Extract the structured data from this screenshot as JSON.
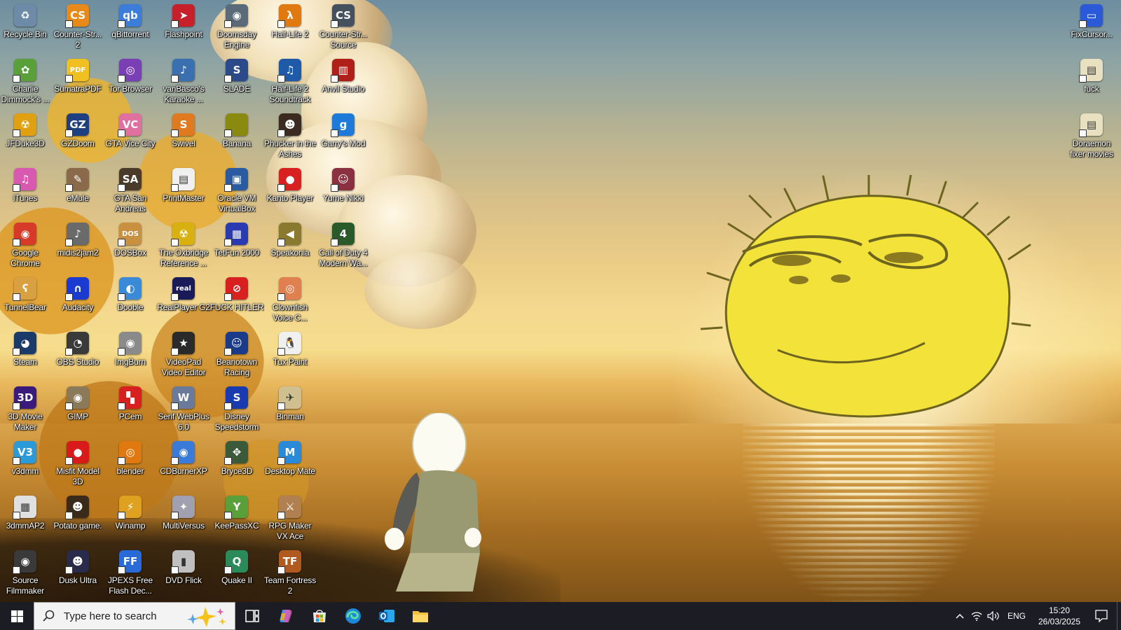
{
  "desktop": {
    "icons": [
      {
        "label": "Recycle Bin",
        "color": "#6d8aa8",
        "glyph": "♻",
        "shortcut": false
      },
      {
        "label": "Counter-Str... 2",
        "color": "#e88a1a",
        "glyph": "CS"
      },
      {
        "label": "qBittorrent",
        "color": "#3b7dd8",
        "glyph": "qb"
      },
      {
        "label": "Flashpoint",
        "color": "#c8202a",
        "glyph": "➤"
      },
      {
        "label": "Doomsday Engine",
        "color": "#5a6a78",
        "glyph": "◉"
      },
      {
        "label": "Half-Life 2",
        "color": "#e07a10",
        "glyph": "λ"
      },
      {
        "label": "Counter-Str... Source",
        "color": "#45505e",
        "glyph": "CS"
      },
      {
        "label": "Charlie Dimmock's ...",
        "color": "#5aa03a",
        "glyph": "✿"
      },
      {
        "label": "SumatraPDF",
        "color": "#f0c020",
        "glyph": "PDF"
      },
      {
        "label": "Tor Browser",
        "color": "#7a3fb5",
        "glyph": "◎"
      },
      {
        "label": "vanBasco's Karaoke ...",
        "color": "#3a6fb0",
        "glyph": "♪"
      },
      {
        "label": "SLADE",
        "color": "#2a4a8a",
        "glyph": "S"
      },
      {
        "label": "Half-Life 2 Soundtrack",
        "color": "#1e5aa8",
        "glyph": "♫"
      },
      {
        "label": "Anvil Studio",
        "color": "#b0201a",
        "glyph": "▥"
      },
      {
        "label": "JFDuke3D",
        "color": "#e0a010",
        "glyph": "☢"
      },
      {
        "label": "GZDoom",
        "color": "#1e3f80",
        "glyph": "GZ"
      },
      {
        "label": "GTA Vice City",
        "color": "#e070a0",
        "glyph": "VC"
      },
      {
        "label": "Swivel",
        "color": "#e07a20",
        "glyph": "S"
      },
      {
        "label": "Banana",
        "color": "#8a8a10",
        "glyph": ""
      },
      {
        "label": "Phucker in the Ashes",
        "color": "#3a2a20",
        "glyph": "☻"
      },
      {
        "label": "Garry's Mod",
        "color": "#1e7ad8",
        "glyph": "g"
      },
      {
        "label": "iTunes",
        "color": "#d85ab0",
        "glyph": "♫"
      },
      {
        "label": "eMule",
        "color": "#8a6a4a",
        "glyph": "✎"
      },
      {
        "label": "GTA San Andreas",
        "color": "#4a3a2a",
        "glyph": "SA"
      },
      {
        "label": "PrintMaster",
        "color": "#f0f0f0",
        "glyph": "▤"
      },
      {
        "label": "Oracle VM VirtualBox",
        "color": "#2a5aa0",
        "glyph": "▣"
      },
      {
        "label": "Kanto Player",
        "color": "#d82020",
        "glyph": "●"
      },
      {
        "label": "Yume Nikki",
        "color": "#8a3040",
        "glyph": "☺"
      },
      {
        "label": "Google Chrome",
        "color": "#d83a2a",
        "glyph": "◉"
      },
      {
        "label": "midis2jam2",
        "color": "#6a6a6a",
        "glyph": "♪"
      },
      {
        "label": "DOSBox",
        "color": "#c89040",
        "glyph": "DOS"
      },
      {
        "label": "The Oxbridge Reference ...",
        "color": "#d8b010",
        "glyph": "☢"
      },
      {
        "label": "TetFun 2000",
        "color": "#2a3ab0",
        "glyph": "▦"
      },
      {
        "label": "Speakonia",
        "color": "#8a7a30",
        "glyph": "◀"
      },
      {
        "label": "Call of Duty 4 Modern Wa...",
        "color": "#2a5a2a",
        "glyph": "4"
      },
      {
        "label": "TunnelBear",
        "color": "#d8a040",
        "glyph": "ʕ"
      },
      {
        "label": "Audacity",
        "color": "#1a3ad0",
        "glyph": "∩"
      },
      {
        "label": "Dooble",
        "color": "#3a8ad8",
        "glyph": "◐"
      },
      {
        "label": "RealPlayer G2",
        "color": "#1a1a5a",
        "glyph": "real"
      },
      {
        "label": "FUCK HITLER",
        "color": "#d82020",
        "glyph": "⊘"
      },
      {
        "label": "Clownfish Voice C...",
        "color": "#e08050",
        "glyph": "◎"
      },
      {
        "label": "Steam",
        "color": "#1a3a6a",
        "glyph": "◕"
      },
      {
        "label": "OBS Studio",
        "color": "#3a3a3a",
        "glyph": "◔"
      },
      {
        "label": "ImgBurn",
        "color": "#8a8a8a",
        "glyph": "◉"
      },
      {
        "label": "VideoPad Video Editor",
        "color": "#2a2a2a",
        "glyph": "★"
      },
      {
        "label": "Beanotown Racing",
        "color": "#1a3a8a",
        "glyph": "☺"
      },
      {
        "label": "Tux Paint",
        "color": "#f0f0f0",
        "glyph": "🐧"
      },
      {
        "label": "3D Movie Maker",
        "color": "#3a1a7a",
        "glyph": "3D"
      },
      {
        "label": "GIMP",
        "color": "#8a7a5a",
        "glyph": "◉"
      },
      {
        "label": "PCem",
        "color": "#d82020",
        "glyph": "▚"
      },
      {
        "label": "Serif WebPlus 6.0",
        "color": "#6a7a9a",
        "glyph": "W"
      },
      {
        "label": "Disney Speedstorm",
        "color": "#1a3ab0",
        "glyph": "S"
      },
      {
        "label": "Binman",
        "color": "#d0c090",
        "glyph": "✈"
      },
      {
        "label": "v3dmm",
        "color": "#2a9ad8",
        "glyph": "V3"
      },
      {
        "label": "Misfit Model 3D",
        "color": "#d81a1a",
        "glyph": "●"
      },
      {
        "label": "blender",
        "color": "#e07a10",
        "glyph": "◎"
      },
      {
        "label": "CDBurnerXP",
        "color": "#3a7ad8",
        "glyph": "◉"
      },
      {
        "label": "Bryce3D",
        "color": "#3a5a3a",
        "glyph": "✥"
      },
      {
        "label": "Desktop Mate",
        "color": "#2a8ad8",
        "glyph": "M"
      },
      {
        "label": "3dmmAP2",
        "color": "#e0e0e0",
        "glyph": "▦"
      },
      {
        "label": "Potato game.",
        "color": "#3a2a1a",
        "glyph": "☻"
      },
      {
        "label": "Winamp",
        "color": "#e0a020",
        "glyph": "⚡"
      },
      {
        "label": "MultiVersus",
        "color": "#a0a0b0",
        "glyph": "✦"
      },
      {
        "label": "KeePassXC",
        "color": "#5aa03a",
        "glyph": "Y"
      },
      {
        "label": "RPG Maker VX Ace",
        "color": "#b08050",
        "glyph": "⚔"
      },
      {
        "label": "Source Filmmaker",
        "color": "#3a3a3a",
        "glyph": "◉"
      },
      {
        "label": "Dusk Ultra",
        "color": "#2a2a4a",
        "glyph": "☻"
      },
      {
        "label": "JPEXS Free Flash Dec...",
        "color": "#2a6ad8",
        "glyph": "FF"
      },
      {
        "label": "DVD Flick",
        "color": "#c0c0c0",
        "glyph": "▮"
      },
      {
        "label": "Quake II",
        "color": "#2a8a5a",
        "glyph": "Q"
      },
      {
        "label": "Team Fortress 2",
        "color": "#b05a20",
        "glyph": "TF"
      }
    ],
    "right_icons": [
      {
        "label": "FixCursor...",
        "color": "#2a5ad8",
        "glyph": "▭"
      },
      {
        "label": "fuck",
        "color": "#e8e0c0",
        "glyph": "▤"
      },
      {
        "label": "Doraemon fixer movies",
        "color": "#e8e0c0",
        "glyph": "▤"
      }
    ]
  },
  "taskbar": {
    "search_placeholder": "Type here to search",
    "apps": [
      "task-view",
      "copilot",
      "microsoft-store",
      "edge",
      "outlook",
      "file-explorer"
    ],
    "language": "ENG",
    "time": "15:20",
    "date": "26/03/2025"
  }
}
